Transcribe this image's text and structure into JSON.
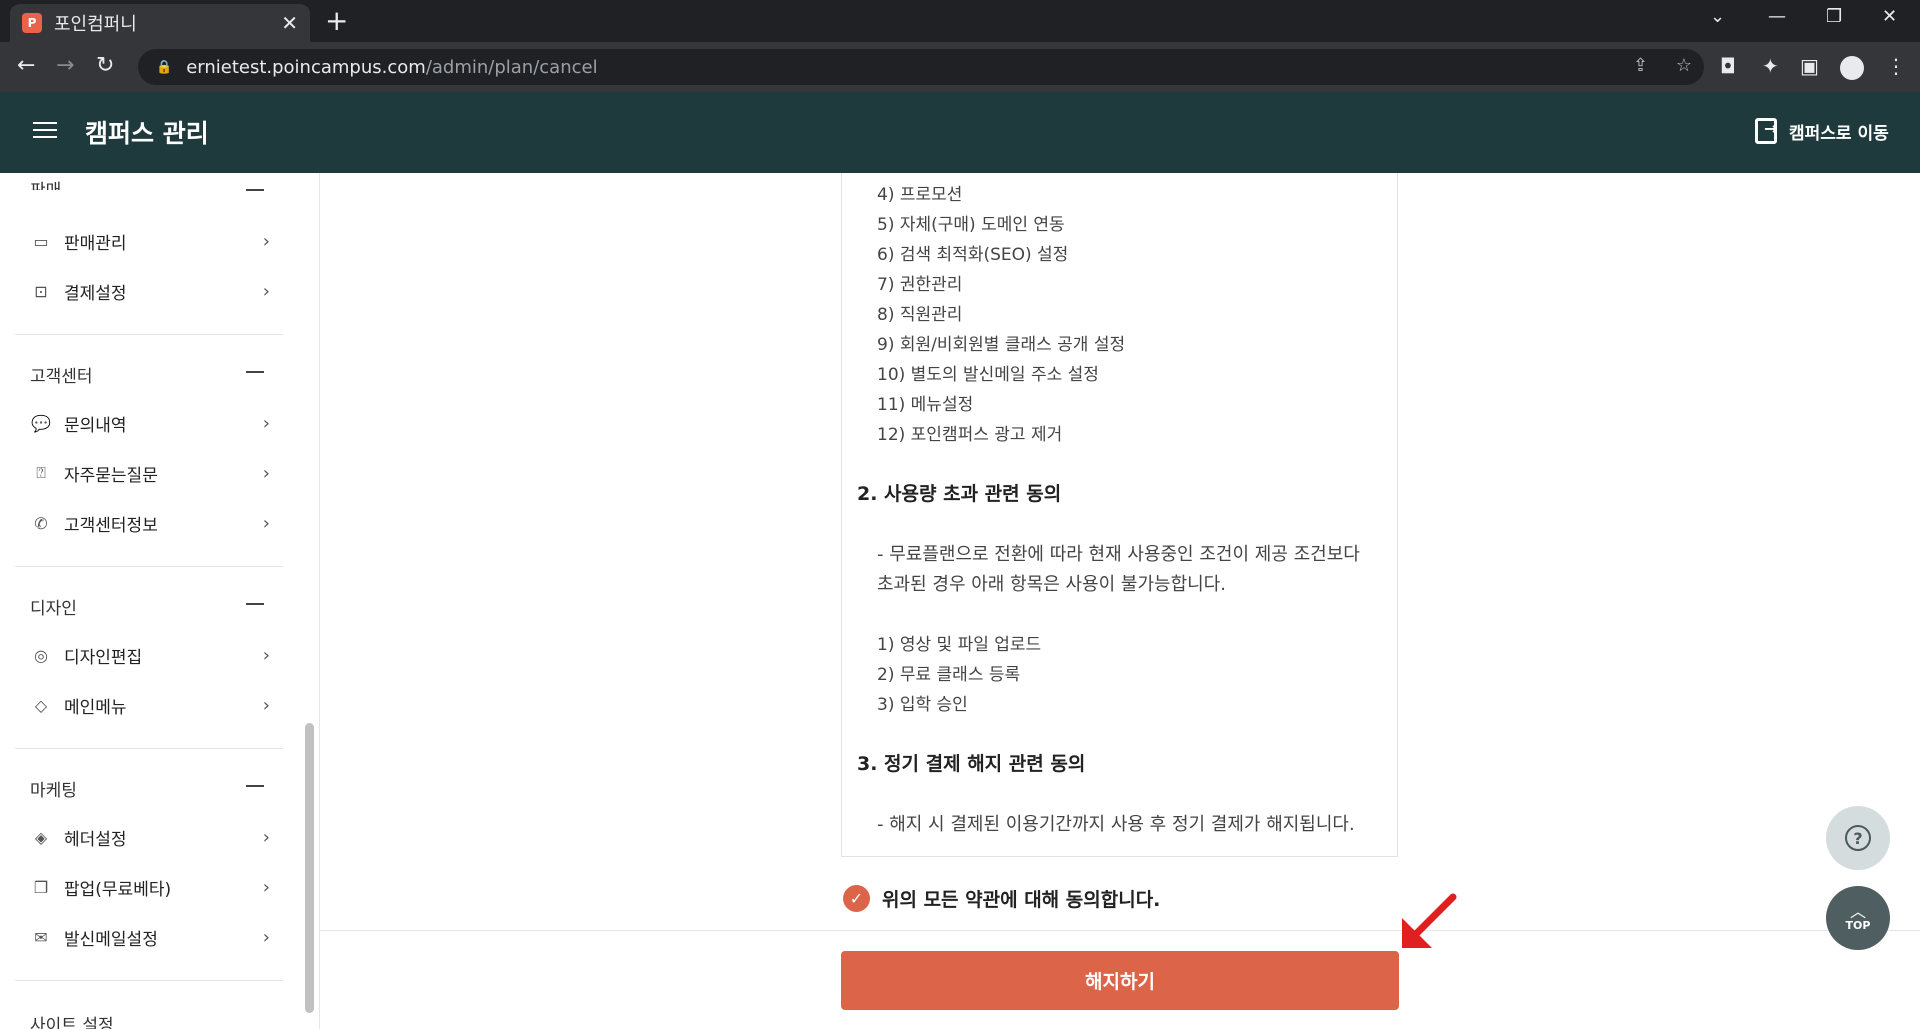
{
  "browser": {
    "tab_title": "포인컴퍼니",
    "tab_icon": "P",
    "url_host": "ernietest.poincampus.com",
    "url_path": "/admin/plan/cancel"
  },
  "header": {
    "title": "캠퍼스 관리",
    "move_label": "캠퍼스로 이동"
  },
  "sidebar": {
    "sections": [
      {
        "title": "판매",
        "items": [
          {
            "label": "판매관리",
            "icon": "card-icon"
          },
          {
            "label": "결제설정",
            "icon": "bag-icon"
          }
        ]
      },
      {
        "title": "고객센터",
        "items": [
          {
            "label": "문의내역",
            "icon": "chat-icon"
          },
          {
            "label": "자주묻는질문",
            "icon": "question-icon"
          },
          {
            "label": "고객센터정보",
            "icon": "phone-icon"
          }
        ]
      },
      {
        "title": "디자인",
        "items": [
          {
            "label": "디자인편집",
            "icon": "palette-icon"
          },
          {
            "label": "메인메뉴",
            "icon": "tag-icon"
          }
        ]
      },
      {
        "title": "마케팅",
        "items": [
          {
            "label": "헤더설정",
            "icon": "header-icon"
          },
          {
            "label": "팝업(무료베타)",
            "icon": "popup-icon"
          },
          {
            "label": "발신메일설정",
            "icon": "mail-icon"
          }
        ]
      },
      {
        "title": "사이트 설정"
      }
    ]
  },
  "terms": {
    "list1": [
      "4) 프로모션",
      "5) 자체(구매) 도메인 연동",
      "6) 검색 최적화(SEO) 설정",
      "7) 권한관리",
      "8) 직원관리",
      "9) 회원/비회원별 클래스 공개 설정",
      "10) 별도의 발신메일 주소 설정",
      "11) 메뉴설정",
      "12) 포인캠퍼스 광고 제거"
    ],
    "heading2": "2. 사용량 초과 관련 동의",
    "para2_line1": "- 무료플랜으로 전환에 따라 현재 사용중인 조건이 제공 조건보다",
    "para2_line2": "초과된 경우 아래 항목은 사용이 불가능합니다.",
    "list2": [
      "1) 영상 및 파일 업로드",
      "2) 무료 클래스 등록",
      "3) 입학 승인"
    ],
    "heading3": "3. 정기 결제 해지 관련 동의",
    "para3": "- 해지 시 결제된 이용기간까지 사용 후 정기 결제가 해지됩니다."
  },
  "agree_label": "위의 모든 약관에 대해 동의합니다.",
  "cancel_button": "해지하기",
  "top_label": "TOP",
  "colors": {
    "accent": "#dc6549",
    "header_bg": "#1f3a3d"
  }
}
